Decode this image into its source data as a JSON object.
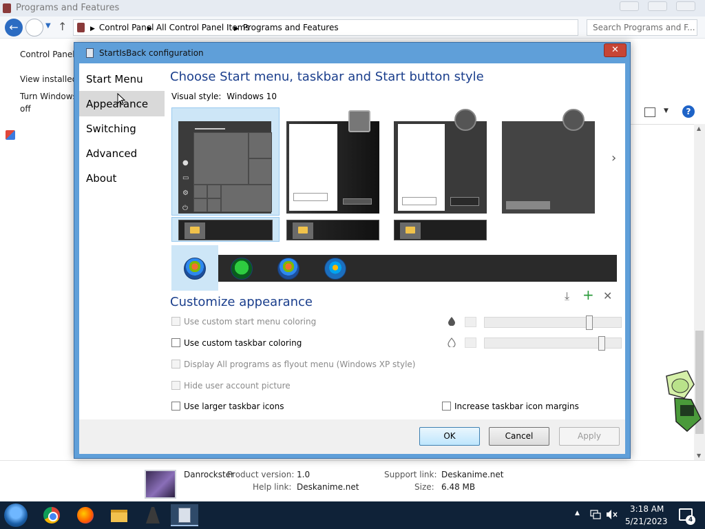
{
  "explorer": {
    "window_title": "Programs and Features",
    "breadcrumb": [
      "Control Panel",
      "All Control Panel Items",
      "Programs and Features"
    ],
    "search_placeholder": "Search Programs and F...",
    "left_links": [
      "Control Panel",
      "View installed",
      "Turn Windows",
      "off"
    ],
    "details": {
      "publisher": "Danrockster",
      "product_version_label": "Product version:",
      "product_version": "1.0",
      "help_link_label": "Help link:",
      "help_link": "Deskanime.net",
      "support_link_label": "Support link:",
      "support_link": "Deskanime.net",
      "size_label": "Size:",
      "size": "6.48 MB"
    }
  },
  "dialog": {
    "title": "StartIsBack configuration",
    "close_glyph": "✕",
    "sidebar": [
      "Start Menu",
      "Appearance",
      "Switching",
      "Advanced",
      "About"
    ],
    "active_section": "Appearance",
    "heading": "Choose Start menu, taskbar and Start button style",
    "visual_style_label": "Visual style:",
    "visual_style_value": "Windows 10",
    "next_arrow": "›",
    "customize_heading": "Customize appearance",
    "tools": {
      "download": "⤓",
      "add": "+",
      "remove": "✕"
    },
    "options": {
      "custom_start_coloring": "Use custom start menu coloring",
      "custom_taskbar_coloring": "Use custom taskbar coloring",
      "flyout_menu": "Display All programs as flyout menu (Windows XP style)",
      "hide_user_picture": "Hide user account picture",
      "larger_icons": "Use larger taskbar icons",
      "icon_margins": "Increase taskbar icon margins"
    },
    "slider_levels": {
      "start_menu_opacity": 0.78,
      "taskbar_opacity": 0.88
    },
    "buttons": {
      "ok": "OK",
      "cancel": "Cancel",
      "apply": "Apply"
    }
  },
  "taskbar": {
    "time": "3:18 AM",
    "date": "5/21/2023",
    "notification_count": "4",
    "apps": [
      "start-orb",
      "chrome-icon",
      "firefox-icon",
      "file-explorer-icon",
      "inkscape-icon",
      "startisback-icon"
    ]
  },
  "colors": {
    "heading_blue": "#1a3e8c",
    "dialog_frame": "#5f9fd9",
    "selection": "#cde6f7",
    "taskbar": "#0f2238"
  }
}
